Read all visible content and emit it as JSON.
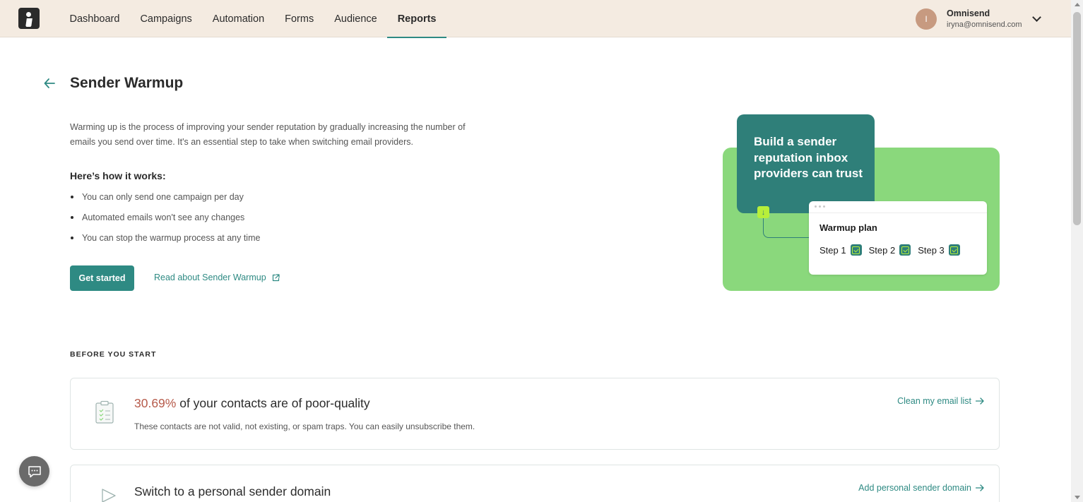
{
  "nav": {
    "items": [
      "Dashboard",
      "Campaigns",
      "Automation",
      "Forms",
      "Audience",
      "Reports"
    ],
    "active": "Reports"
  },
  "user": {
    "initial": "I",
    "name": "Omnisend",
    "email": "iryna@omnisend.com"
  },
  "page": {
    "title": "Sender Warmup",
    "intro": "Warming up is the process of improving your sender reputation by gradually increasing the number of emails you send over time. It's an essential step to take when switching email providers.",
    "how_title": "Here’s how it works:",
    "bullets": [
      "You can only send one campaign per day",
      "Automated emails won't see any changes",
      "You can stop the warmup process at any time"
    ],
    "primary_button": "Get started",
    "read_link": "Read about Sender Warmup"
  },
  "illustration": {
    "headline": "Build a sender reputation inbox providers can trust",
    "plan_title": "Warmup plan",
    "steps": [
      "Step 1",
      "Step 2",
      "Step 3"
    ]
  },
  "before_you_start": {
    "label": "BEFORE YOU START",
    "cards": [
      {
        "percent": "30.69%",
        "title_rest": " of your contacts are of poor-quality",
        "description": "These contacts are not valid, not existing, or spam traps. You can easily unsubscribe them.",
        "link": "Clean my email list"
      },
      {
        "title": "Switch to a personal sender domain",
        "link": "Add personal sender domain"
      }
    ]
  },
  "colors": {
    "accent": "#2e8a83",
    "nav_bg": "#f4ebe1",
    "illustration_green": "#8ad87c",
    "illustration_teal": "#2f7f79",
    "lime": "#b7ef3a",
    "warning_percent": "#b65a4a"
  }
}
